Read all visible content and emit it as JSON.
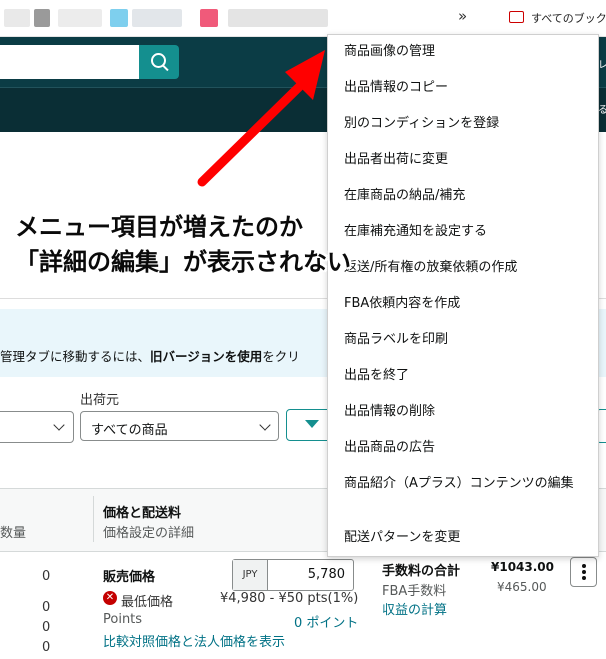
{
  "bookmarks_bar": {
    "overflow_symbol": "»",
    "all_bookmarks_label": "すべてのブックマ"
  },
  "filters": {
    "ship_from_label": "出荷元",
    "ship_from_value": "すべての商品"
  },
  "banner": {
    "text_prefix": "管理タブに移動するには、",
    "text_bold": "旧バージョンを使用",
    "text_suffix": "をクリ"
  },
  "table": {
    "qty_header": "数量",
    "price_header": "価格と配送料",
    "price_subheader": "価格設定の詳細",
    "qty_values": [
      "0",
      "0",
      "0",
      "0"
    ]
  },
  "row": {
    "price_title": "販売価格",
    "currency": "JPY",
    "price_value": "5,780",
    "min_price_label": "最低価格",
    "min_price_value": "¥4,980 - ¥50 pts(1%)",
    "points_label": "Points",
    "points_value": "0 ポイント",
    "compare_link": "比較対照価格と法人価格を表示",
    "fee_total_label": "手数料の合計",
    "fee_total_value": "¥1043.00",
    "fba_fee_label": "FBA手数料",
    "fba_fee_value": "¥465.00",
    "profit_link": "収益の計算"
  },
  "dropdown_menu": {
    "items": [
      "商品画像の管理",
      "出品情報のコピー",
      "別のコンディションを登録",
      "出品者出荷に変更",
      "在庫商品の納品/補充",
      "在庫補充通知を設定する",
      "返送/所有権の放棄依頼の作成",
      "FBA依頼内容を作成",
      "商品ラベルを印刷",
      "出品を終了",
      "出品情報の削除",
      "出品商品の広告",
      "商品紹介（Aプラス）コンテンツの編集",
      "配送パターンを変更"
    ]
  },
  "annotation": {
    "line1": "メニュー項目が増えたのか",
    "line2": "「詳細の編集」が表示されない",
    "color": "#ff0000"
  }
}
